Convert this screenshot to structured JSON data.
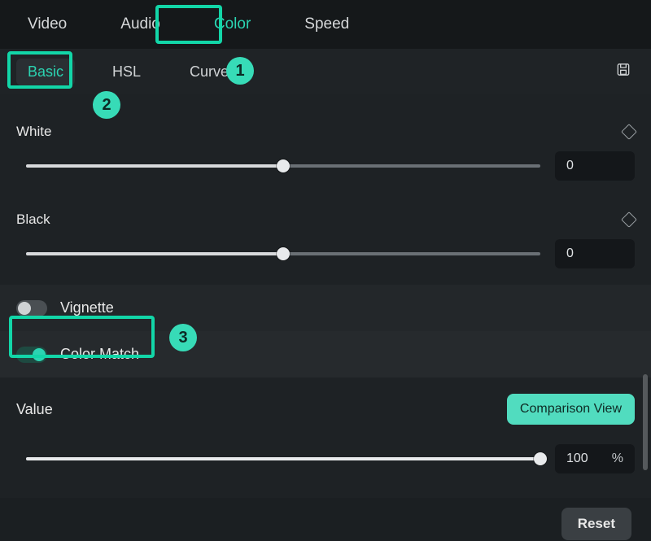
{
  "topTabs": {
    "items": [
      "Video",
      "Audio",
      "Color",
      "Speed"
    ],
    "activeIndex": 2
  },
  "subTabs": {
    "items": [
      "Basic",
      "HSL",
      "Curves"
    ],
    "activeIndex": 0
  },
  "sliders": {
    "white": {
      "label": "White",
      "value": "0",
      "percent": 50
    },
    "black": {
      "label": "Black",
      "value": "0",
      "percent": 50
    },
    "cmValue": {
      "label": "Value",
      "value": "100",
      "unit": "%",
      "percent": 100
    }
  },
  "toggles": {
    "vignette": {
      "label": "Vignette",
      "on": false
    },
    "colorMatch": {
      "label": "Color Match",
      "on": true
    }
  },
  "buttons": {
    "comparisonView": "Comparison View",
    "reset": "Reset"
  },
  "annotations": {
    "n1": "1",
    "n2": "2",
    "n3": "3"
  }
}
